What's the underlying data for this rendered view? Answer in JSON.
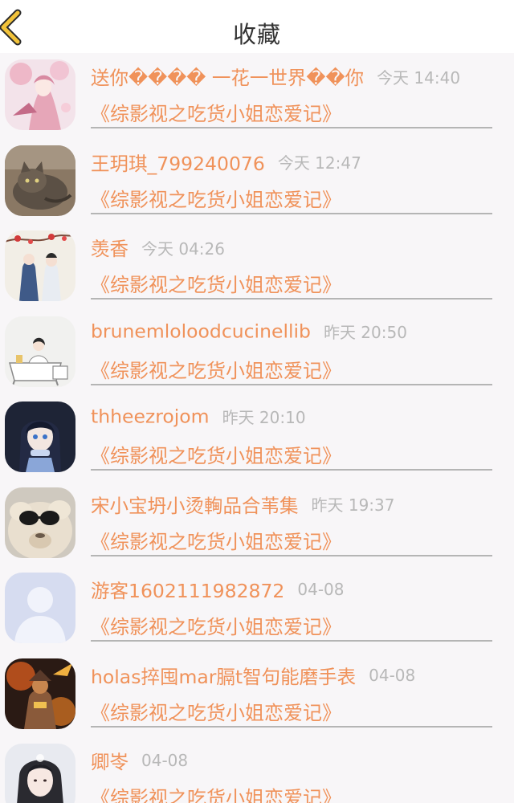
{
  "header": {
    "title": "收藏",
    "back_icon": "chevron-left-icon",
    "back_color": "#f2c33a"
  },
  "colors": {
    "accent": "#f0925a",
    "time": "#b8b8b8",
    "divider": "#b5b5b5"
  },
  "favorites": [
    {
      "name": "送你����  一花一世界��你",
      "time": "今天 14:40",
      "book": "《综影视之吃货小姐恋爱记》",
      "avatar": "avatar-anime-pink-blossom"
    },
    {
      "name": "王玥琪_799240076",
      "time": "今天 12:47",
      "book": "《综影视之吃货小姐恋爱记》",
      "avatar": "avatar-cat"
    },
    {
      "name": "羡香",
      "time": "今天 04:26",
      "book": "《综影视之吃货小姐恋爱记》",
      "avatar": "avatar-ancient-couple"
    },
    {
      "name": "brunemloloodcucinellib",
      "time": "昨天 20:50",
      "book": "《综影视之吃货小姐恋爱记》",
      "avatar": "avatar-bathtub-illustration"
    },
    {
      "name": "thheezrojom",
      "time": "昨天 20:10",
      "book": "《综影视之吃货小姐恋爱记》",
      "avatar": "avatar-anime-girl-dark"
    },
    {
      "name": "宋小宝坍小烫䡘品合苇集",
      "time": "昨天 19:37",
      "book": "《综影视之吃货小姐恋爱记》",
      "avatar": "avatar-alpaca-sunglasses"
    },
    {
      "name": "游客1602111982872",
      "time": "04-08",
      "book": "《综影视之吃货小姐恋爱记》",
      "avatar": "avatar-default-person"
    },
    {
      "name": "holas捽囤mar膈t智句能磨手表",
      "time": "04-08",
      "book": "《综影视之吃货小姐恋爱记》",
      "avatar": "avatar-game-warrior"
    },
    {
      "name": "卿岺",
      "time": "04-08",
      "book": "《综影视之吃货小姐恋爱记》",
      "avatar": "avatar-girl-portrait"
    }
  ]
}
